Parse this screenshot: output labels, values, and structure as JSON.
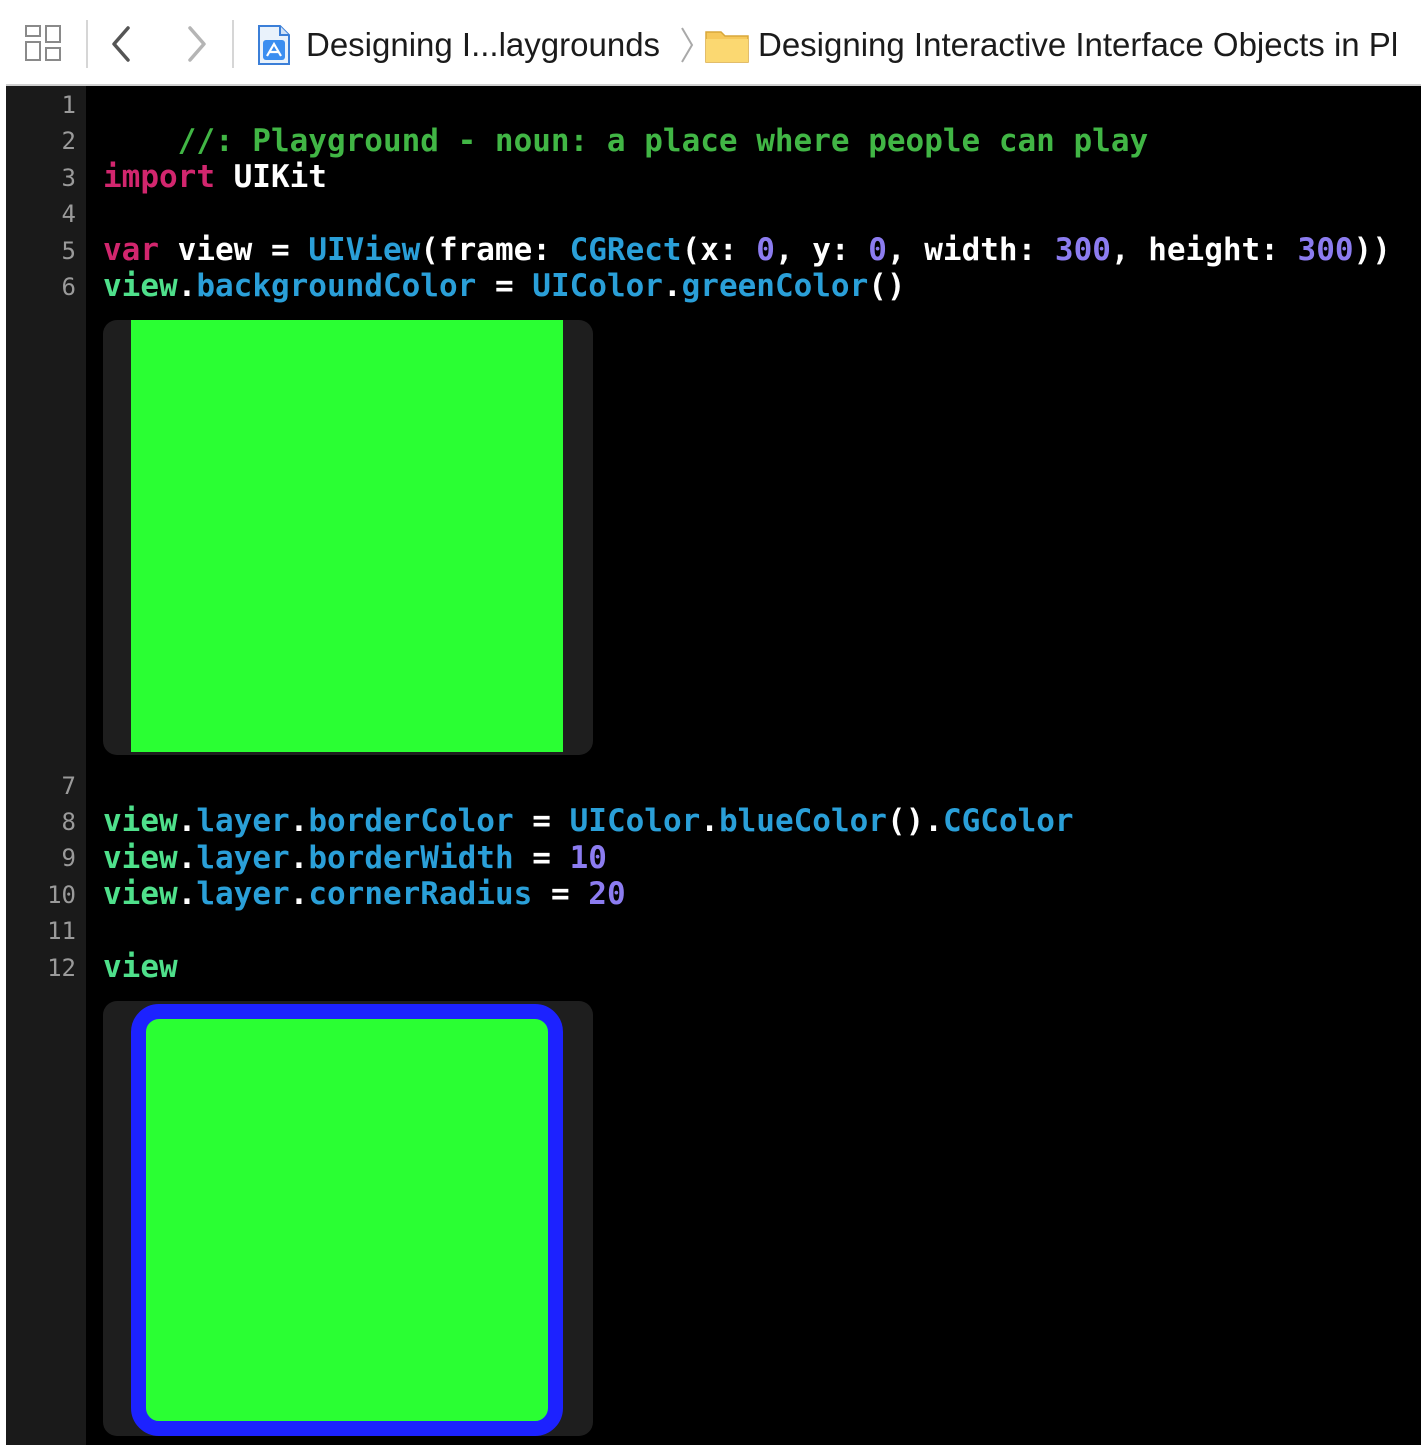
{
  "toolbar": {
    "crumb_project": "Designing I...laygrounds",
    "crumb_folder": "Designing Interactive Interface Objects in Pl",
    "icons": [
      "grid-icon",
      "back-chevron-icon",
      "forward-chevron-icon",
      "playground-file-icon",
      "breadcrumb-chevron-icon",
      "folder-icon"
    ]
  },
  "editor": {
    "line_numbers": [
      "1",
      "2",
      "3",
      "4",
      "5",
      "6",
      "7",
      "8",
      "9",
      "10",
      "11",
      "12"
    ],
    "line1": {
      "comment": "//: Playground - noun: a place where people can play"
    },
    "line3": {
      "kw": "import",
      "rest": " UIKit"
    },
    "line5": {
      "kw": "var",
      "t1": " view = ",
      "uiview": "UIView",
      "t2": "(frame: ",
      "cgrect": "CGRect",
      "t3": "(x: ",
      "x": "0",
      "t4": ", y: ",
      "y": "0",
      "t5": ", width: ",
      "w": "300",
      "t6": ", height: ",
      "h": "300",
      "t7": "))"
    },
    "line6": {
      "v": "view",
      "dot": ".",
      "prop": "backgroundColor",
      "eq": " = ",
      "cls": "UIColor",
      "dot2": ".",
      "method": "greenColor",
      "paren": "()"
    },
    "line8": {
      "v": "view",
      "dot": ".",
      "layer": "layer",
      "dot2": ".",
      "prop": "borderColor",
      "eq": " = ",
      "cls": "UIColor",
      "dot3": ".",
      "method": "blueColor",
      "paren": "()",
      "dot4": ".",
      "cg": "CGColor"
    },
    "line9": {
      "v": "view",
      "dot": ".",
      "layer": "layer",
      "dot2": ".",
      "prop": "borderWidth",
      "eq": " = ",
      "val": "10"
    },
    "line10": {
      "v": "view",
      "dot": ".",
      "layer": "layer",
      "dot2": ".",
      "prop": "cornerRadius",
      "eq": " = ",
      "val": "20"
    },
    "line12": {
      "v": "view"
    }
  },
  "colors": {
    "view_background": "#2aff33",
    "view_border": "#1c22ff"
  }
}
